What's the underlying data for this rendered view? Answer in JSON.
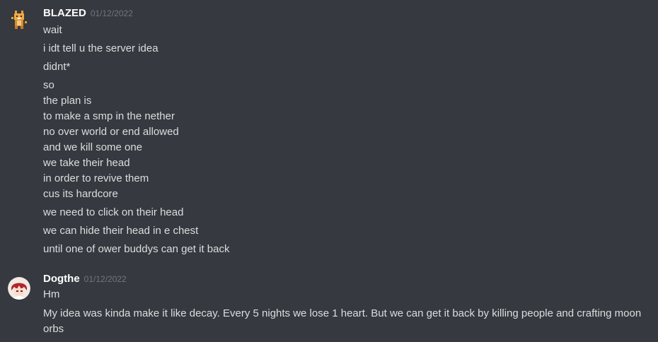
{
  "messages": [
    {
      "username": "BLAZED",
      "timestamp": "01/12/2022",
      "avatar_icon": "pixel-fox-avatar",
      "lines": [
        "wait",
        "i idt tell u the server idea",
        "didnt*",
        "so",
        "the plan is",
        "to make a smp in the nether",
        "no over world or end allowed",
        "and we kill some one",
        "we take their head",
        "in order to revive them",
        "cus its hardcore",
        "we need to click on their head",
        "we can hide their head in e chest",
        "until one of ower buddys can get it back"
      ]
    },
    {
      "username": "Dogthe",
      "timestamp": "01/12/2022",
      "avatar_icon": "anime-red-hair-avatar",
      "lines": [
        "Hm",
        "My idea was kinda make it like decay. Every 5 nights we lose 1 heart. But we can get it back by killing people and crafting moon orbs"
      ]
    }
  ],
  "colors": {
    "background": "#36393f",
    "username": "#ffffff",
    "timestamp": "#72767d",
    "text": "#dcddde"
  }
}
